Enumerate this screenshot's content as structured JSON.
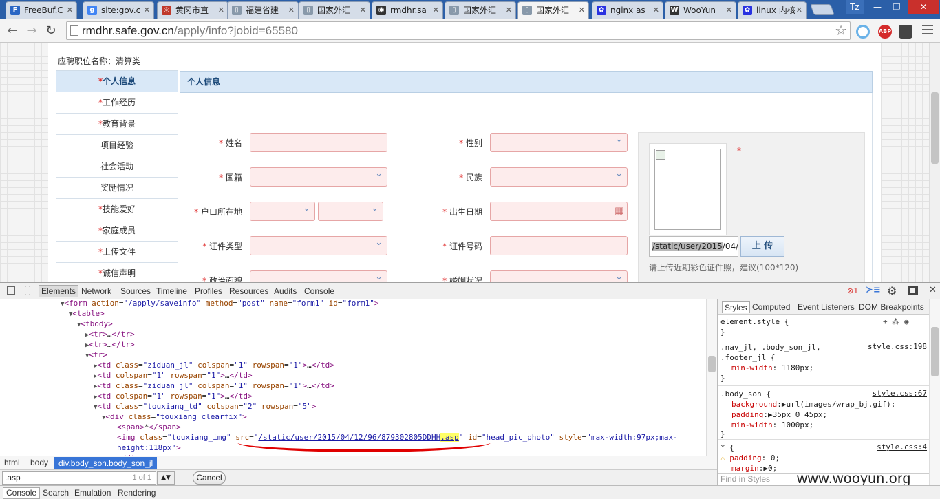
{
  "tabs": [
    {
      "title": "FreeBuf.C",
      "icon": "freebuf-icon",
      "color": "#2a66c4",
      "glyph": "F"
    },
    {
      "title": "site:gov.c",
      "icon": "google-icon",
      "color": "#4285f4",
      "glyph": "g"
    },
    {
      "title": "黄冈市直",
      "icon": "site-icon",
      "color": "#c0392b",
      "glyph": "◎"
    },
    {
      "title": "福建省建",
      "icon": "page-icon",
      "color": "#8899aa",
      "glyph": "▯"
    },
    {
      "title": "国家外汇",
      "icon": "page-icon",
      "color": "#8899aa",
      "glyph": "▯"
    },
    {
      "title": "rmdhr.sa",
      "icon": "github-icon",
      "color": "#333333",
      "glyph": "◉"
    },
    {
      "title": "国家外汇",
      "icon": "page-icon",
      "color": "#8899aa",
      "glyph": "▯"
    },
    {
      "title": "国家外汇",
      "icon": "page-icon",
      "color": "#8899aa",
      "glyph": "▯",
      "active": true
    },
    {
      "title": "nginx as",
      "icon": "baidu-icon",
      "color": "#2932e1",
      "glyph": "✿"
    },
    {
      "title": "WooYun",
      "icon": "wooyun-icon",
      "color": "#333333",
      "glyph": "W"
    },
    {
      "title": "linux 内核",
      "icon": "baidu-icon",
      "color": "#2932e1",
      "glyph": "✿"
    }
  ],
  "window": {
    "profile": "Tz",
    "minimize": "—",
    "restore": "❐",
    "close": "✕"
  },
  "address": {
    "host": "rmdhr.safe.gov.cn",
    "path": "/apply/info?jobid=65580"
  },
  "nav": {
    "back": "←",
    "forward": "→",
    "reload": "↻",
    "star": "☆"
  },
  "extensions": {
    "abp": "ABP"
  },
  "page": {
    "job_label": "应聘职位名称：清算类",
    "sidebar": [
      {
        "label": "个人信息",
        "required": true,
        "active": true
      },
      {
        "label": "工作经历",
        "required": true
      },
      {
        "label": "教育背景",
        "required": true
      },
      {
        "label": "项目经验",
        "required": false
      },
      {
        "label": "社会活动",
        "required": false
      },
      {
        "label": "奖励情况",
        "required": false
      },
      {
        "label": "技能爱好",
        "required": true
      },
      {
        "label": "家庭成员",
        "required": true
      },
      {
        "label": "上传文件",
        "required": true
      },
      {
        "label": "诚信声明",
        "required": true
      }
    ],
    "section_title": "个人信息",
    "fields": {
      "name": "姓名",
      "gender": "性别",
      "nationality": "国籍",
      "ethnicity": "民族",
      "hukou": "户口所在地",
      "birthdate": "出生日期",
      "id_type": "证件类型",
      "id_number": "证件号码",
      "political": "政治面貌",
      "marital": "婚姻状况"
    },
    "required_mark": "*",
    "photo_path": "/static/user/2015",
    "photo_path_rest": "/04/",
    "upload_label": "上 传",
    "photo_hint": "请上传近期彩色证件照，建议(100*120)"
  },
  "devtools": {
    "tabs": [
      "Elements",
      "Network",
      "Sources",
      "Timeline",
      "Profiles",
      "Resources",
      "Audits",
      "Console"
    ],
    "error_count": "1",
    "elements": {
      "form_action": "/apply/saveinfo",
      "form_method": "post",
      "form_name": "form1",
      "form_id": "form1",
      "td_class1": "ziduan_jl",
      "td_class2": "touxiang_td",
      "div_class": "touxiang clearfix",
      "span_text": "*",
      "img_class": "touxiang_img",
      "img_src": "/static/user/2015/04/12/96/879302805DDHH",
      "img_src_ext": ".asp",
      "img_id": "head_pic_photo",
      "img_style": "max-width:97px;max-height:118px"
    },
    "breadcrumbs": [
      "html",
      "body",
      "div.body_son.body_son_jl"
    ],
    "search": {
      "query": ".asp",
      "count": "1 of 1",
      "cancel": "Cancel"
    },
    "drawer": [
      "Console",
      "Search",
      "Emulation",
      "Rendering"
    ],
    "style_tabs": [
      "Styles",
      "Computed",
      "Event Listeners",
      "DOM Breakpoints"
    ],
    "styles": {
      "element_style": "element.style {",
      "rule1_sel": ".nav_jl, .body_son_jl,",
      "rule1_sel2": ".footer_jl {",
      "rule1_src": "style.css:198",
      "rule1_prop": "min-width",
      "rule1_val": "1180px;",
      "rule2_sel": ".body_son {",
      "rule2_src": "style.css:67",
      "rule2_p1": "background",
      "rule2_v1": "url(images/wrap_bj.gif);",
      "rule2_p2": "padding",
      "rule2_v2": "35px 0 45px;",
      "rule2_p3": "min-width",
      "rule2_v3": "1000px;",
      "rule3_sel": "* {",
      "rule3_src": "style.css:4",
      "rule3_p1": "padding",
      "rule3_v1": "0;",
      "rule3_p2": "margin",
      "rule3_v2": "0;",
      "find_placeholder": "Find in Styles",
      "close_brace": "}"
    }
  },
  "watermark": "www.wooyun.org",
  "colors": {
    "accent": "#3875d7",
    "required": "#e03030",
    "highlight": "#ffff66",
    "annotation": "#e00000"
  }
}
